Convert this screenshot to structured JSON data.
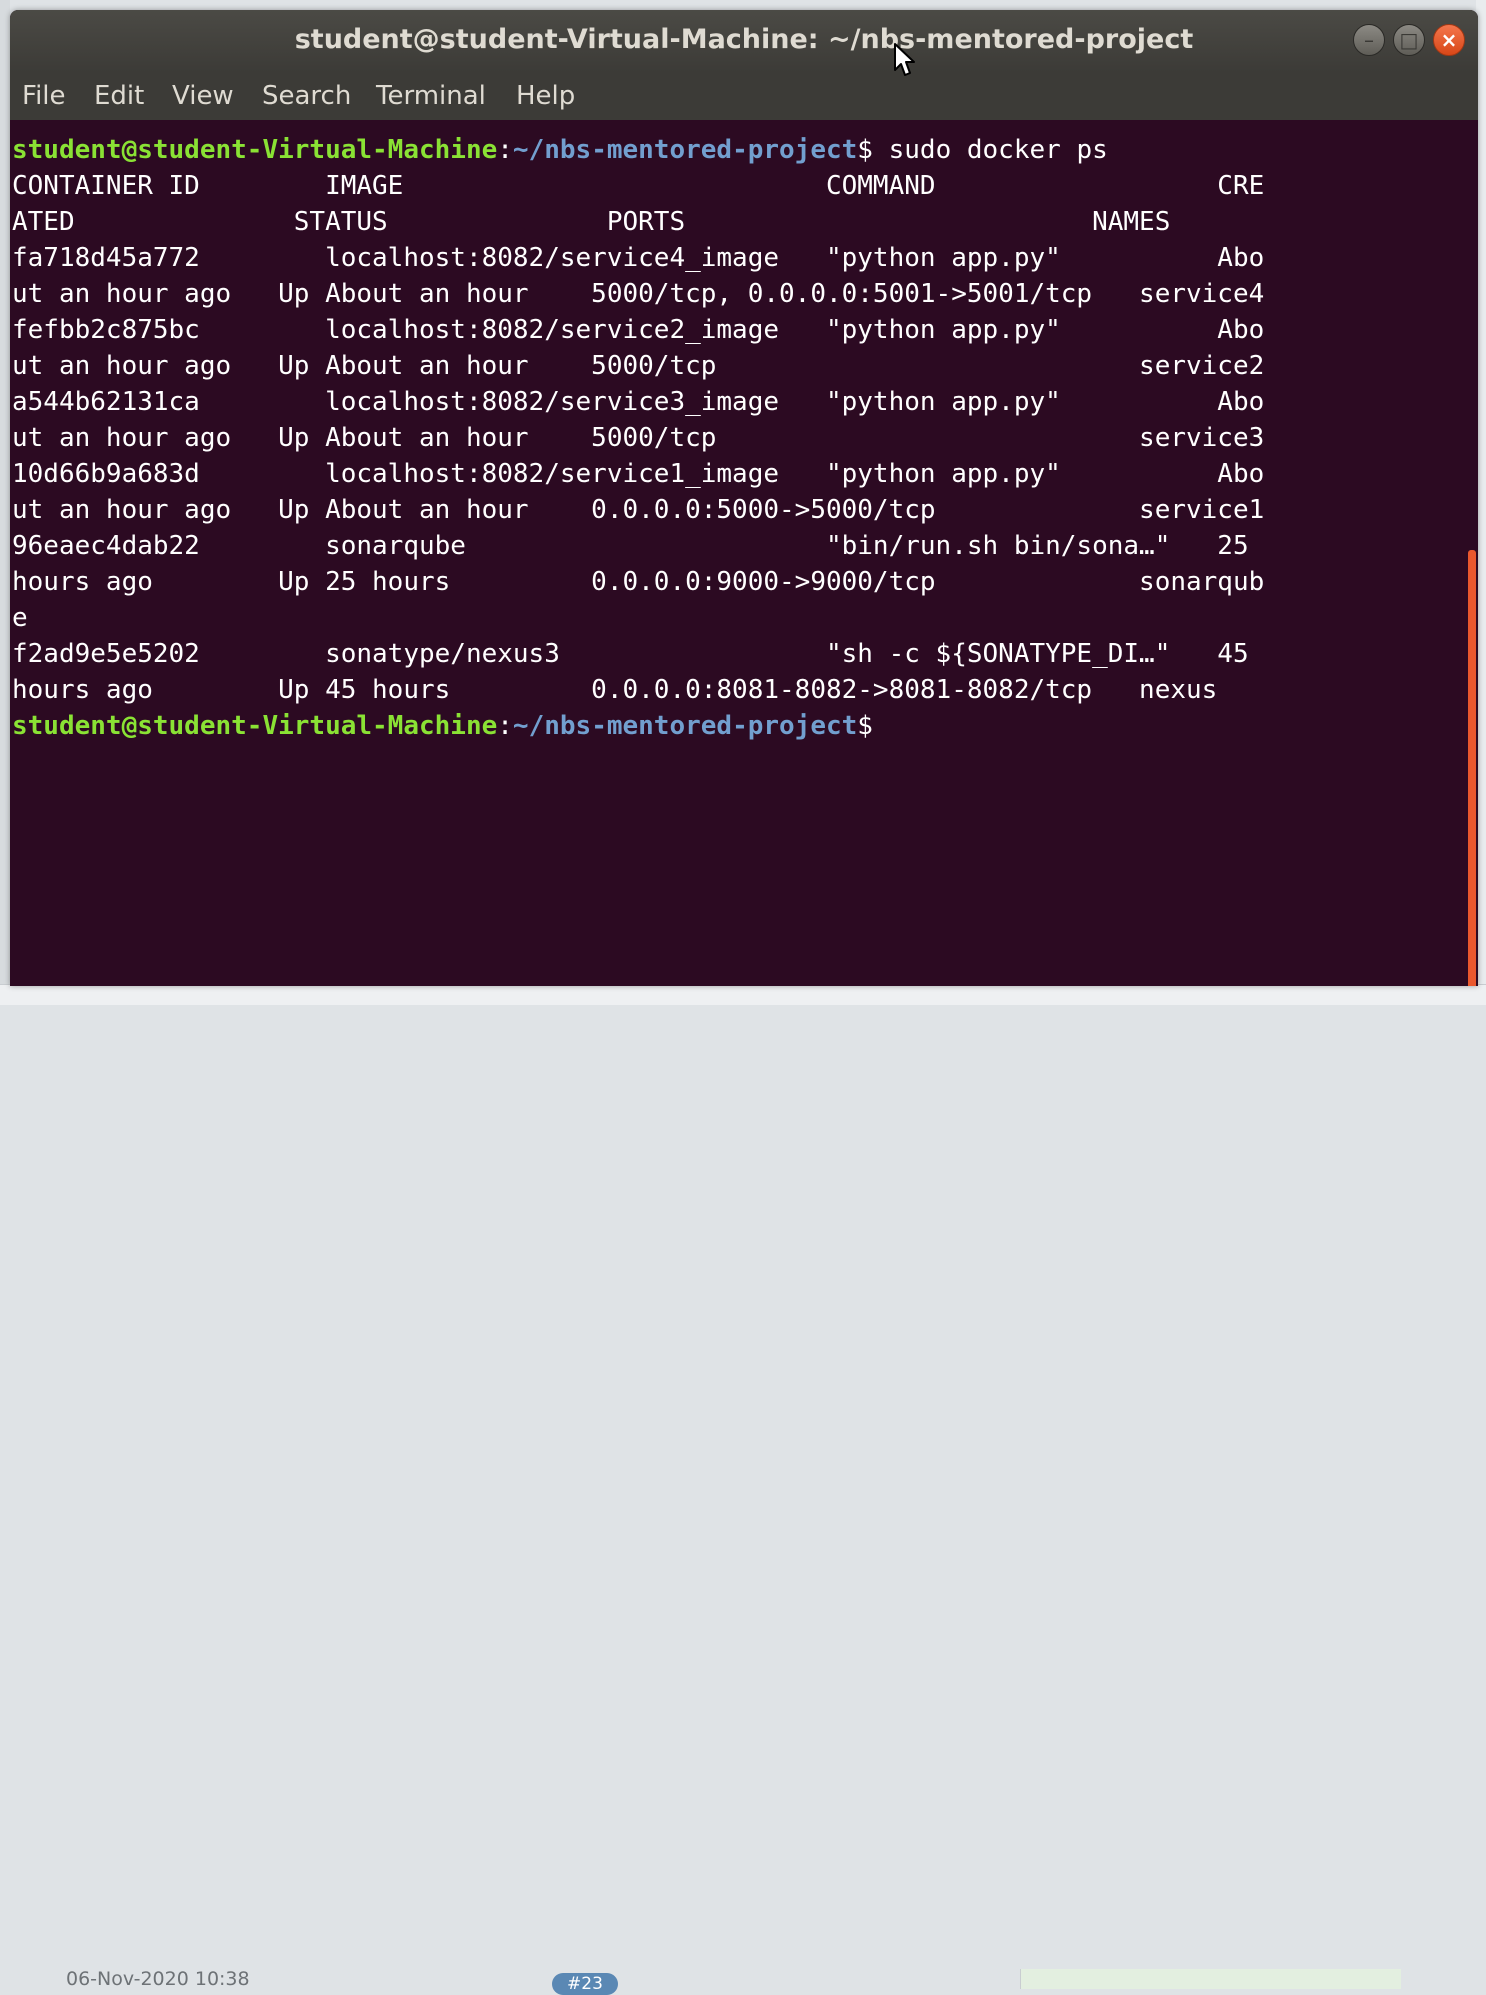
{
  "window": {
    "title": "student@student-Virtual-Machine: ~/nbs-mentored-project",
    "minimize_icon": "minimize-icon",
    "maximize_icon": "maximize-icon",
    "close_icon": "close-icon"
  },
  "menu": {
    "file": "File",
    "edit": "Edit",
    "view": "View",
    "search": "Search",
    "terminal": "Terminal",
    "help": "Help"
  },
  "prompt": {
    "user_host": "student@student-Virtual-Machine",
    "colon": ":",
    "path": "~/nbs-mentored-project",
    "dollar": "$"
  },
  "command": " sudo docker ps",
  "output_lines": [
    "CONTAINER ID        IMAGE                           COMMAND                  CRE",
    "ATED              STATUS              PORTS                          NAMES",
    "fa718d45a772        localhost:8082/service4_image   \"python app.py\"          Abo",
    "ut an hour ago   Up About an hour    5000/tcp, 0.0.0.0:5001->5001/tcp   service4",
    "fefbb2c875bc        localhost:8082/service2_image   \"python app.py\"          Abo",
    "ut an hour ago   Up About an hour    5000/tcp                           service2",
    "a544b62131ca        localhost:8082/service3_image   \"python app.py\"          Abo",
    "ut an hour ago   Up About an hour    5000/tcp                           service3",
    "10d66b9a683d        localhost:8082/service1_image   \"python app.py\"          Abo",
    "ut an hour ago   Up About an hour    0.0.0.0:5000->5000/tcp             service1",
    "96eaec4dab22        sonarqube                       \"bin/run.sh bin/sona…\"   25",
    "hours ago        Up 25 hours         0.0.0.0:9000->9000/tcp             sonarqub",
    "e",
    "f2ad9e5e5202        sonatype/nexus3                 \"sh -c ${SONATYPE_DI…\"   45",
    "hours ago        Up 45 hours         0.0.0.0:8081-8082->8081-8082/tcp   nexus"
  ],
  "background": {
    "date_text": "06-Nov-2020 10:38",
    "badge_text": "#23"
  },
  "colors": {
    "terminal_bg": "#2c0a22",
    "prompt_user": "#8ae234",
    "prompt_path": "#729fcf",
    "close_button": "#e95420"
  }
}
